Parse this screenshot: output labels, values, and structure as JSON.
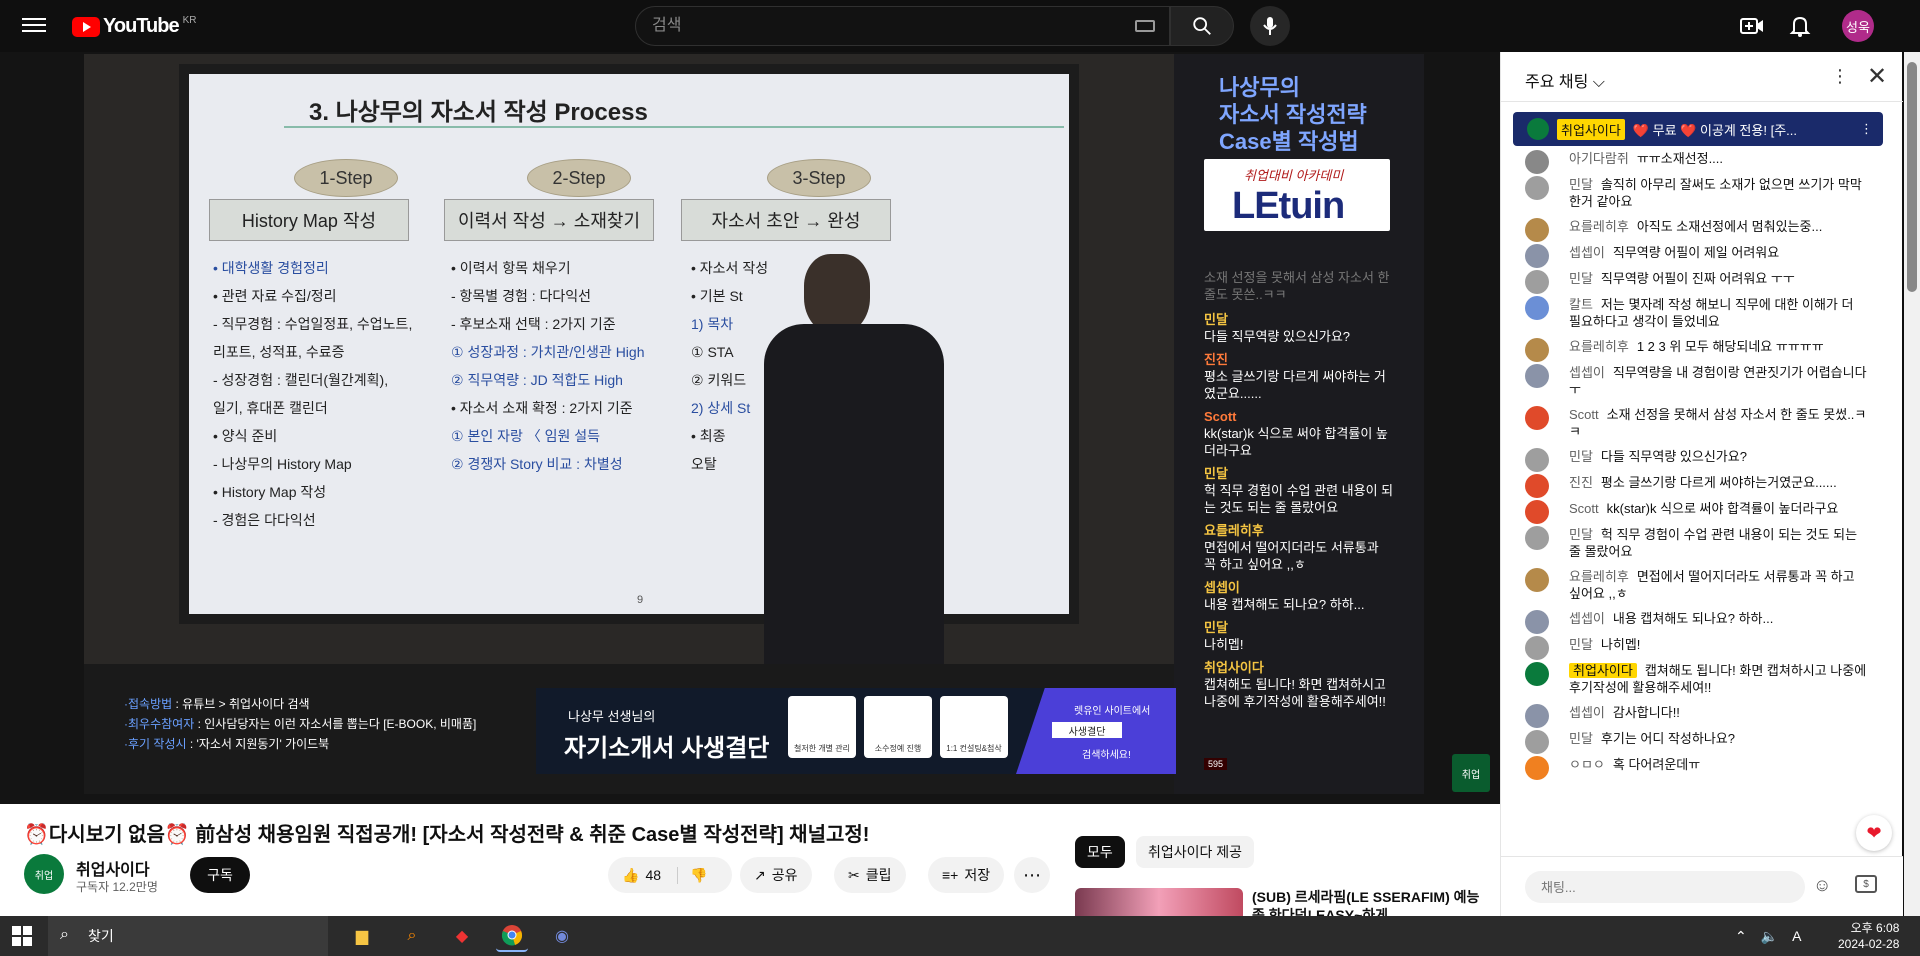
{
  "topbar": {
    "logo_text": "YouTube",
    "logo_country": "KR",
    "search_placeholder": "검색",
    "avatar_label": "성욱"
  },
  "slide": {
    "title": "3. 나상무의 자소서 작성 Process",
    "steps": [
      {
        "pill": "1-Step",
        "box": "History Map 작성"
      },
      {
        "pill": "2-Step",
        "box": "이력서 작성 → 소재찾기"
      },
      {
        "pill": "3-Step",
        "box": "자소서 초안 → 완성"
      }
    ],
    "col1": [
      "• 대학생활 경험정리",
      "• 관련 자료 수집/정리",
      " - 직무경험 : 수업일정표, 수업노트,",
      "   리포트, 성적표, 수료증",
      " - 성장경험 : 캘린더(월간계획),",
      "   일기, 휴대폰 캘린더",
      "• 양식 준비",
      " - 나상무의 History Map",
      "• History Map 작성",
      " - 경험은 다다익선"
    ],
    "col2": [
      "• 이력서 항목 채우기",
      " - 항목별 경험 : 다다익선",
      " - 후보소재 선택 : 2가지 기준",
      " ① 성장과정 : 가치관/인생관 High",
      " ② 직무역량 : JD 적합도 High",
      "• 자소서 소재 확정 : 2가지 기준",
      " ① 본인 자랑 〈 임원 설득",
      " ② 경쟁자 Story 비교 : 차별성"
    ],
    "col3": [
      "• 자소서 작성",
      "• 기본 St",
      " 1) 목차",
      " ① STA",
      " ② 키워드",
      " 2) 상세 St",
      "",
      "",
      "• 최종",
      "   오탈"
    ],
    "page_number": "9"
  },
  "brand": {
    "title_lines": [
      "나상무의",
      "자소서 작성전략",
      "Case별 작성법"
    ],
    "logo_small": "취업대비 아카데미",
    "logo_big": "LEtuin"
  },
  "overlay_chat": {
    "faded": "소재 선정을 못해서 삼성 자소서 한 줄도 못쓴..ㅋㅋ",
    "messages": [
      {
        "name": "민달",
        "text": "다들 직무역량 있으신가요?"
      },
      {
        "name": "진진",
        "text": "평소 글쓰기랑 다르게 써야하는 거였군요......"
      },
      {
        "name": "Scott",
        "text": "kk(star)k 식으로 써야 합격률이 높더라구요"
      },
      {
        "name": "민달",
        "text": "헉 직무 경험이 수업 관련 내용이 되는 것도 되는 줄 몰랐어요"
      },
      {
        "name": "요를레히후",
        "text": "면접에서 떨어지더라도 서류통과 꼭 하고 싶어요 ,,ㅎ"
      },
      {
        "name": "셉셉이",
        "text": "내용 캡쳐해도 되나요? 하하..."
      },
      {
        "name": "민달",
        "text": "나히멥!"
      },
      {
        "name": "취업사이다",
        "text": "캡쳐해도 됩니다! 화면 캡쳐하시고 나중에 후기작성에 활용해주세여!!"
      }
    ],
    "count": "595"
  },
  "bottom_strip": {
    "info": [
      {
        "key": "·접속방법",
        "value": " : 유튜브 > 취업사이다 검색"
      },
      {
        "key": "·최우수참여자",
        "value": " : 인사담당자는 이런 자소서를 뽑는다 [E-BOOK, 비매품]"
      },
      {
        "key": "·후기 작성시",
        "value": " : '자소서 지원동기' 가이드북"
      }
    ],
    "banner_small": "나상무 선생님의",
    "banner_big": "자기소개서 사생결단",
    "cards": [
      "철저한 개별 관리",
      "소수정예 진행",
      "1:1 컨설팅&첨삭"
    ],
    "cta_line1": "렛유인 사이트에서",
    "cta_box": "사생결단",
    "cta_line2": "검색하세요!"
  },
  "below_video": {
    "title": "⏰다시보기 없음⏰ 前삼성 채용임원 직접공개! [자소서 작성전략 & 취준 Case별 작성전략] 채널고정!",
    "channel_name": "취업사이다",
    "channel_subs": "구독자 12.2만명",
    "subscribe_label": "구독",
    "like_count": "48",
    "share_label": "공유",
    "clip_label": "클립",
    "save_label": "저장",
    "chip_all": "모두",
    "chip_provided": "취업사이다 제공",
    "rec_title": "(SUB) 르세라핌(LE SSERAFIM) 예능 좀 한다던! EASY~하게"
  },
  "chat": {
    "header_title": "주요 채팅",
    "pinned_name": "취업사이다",
    "pinned_text": "❤️ 무료 ❤️ 이공계 전용! [주...",
    "messages": [
      {
        "name": "아기다람쥐",
        "text": "ㅠㅠ소재선정....",
        "color": "#888888"
      },
      {
        "name": "민달",
        "text": "솔직히 아무리 잘써도 소재가 없으면 쓰기가 막막한거 같아요",
        "color": "#9e9e9e"
      },
      {
        "name": "요를레히후",
        "text": "아직도 소재선정에서 멈춰있는중...",
        "color": "#b58a4a"
      },
      {
        "name": "셉셉이",
        "text": "직무역량 어필이 제일 어려워요",
        "color": "#8a93a8"
      },
      {
        "name": "민달",
        "text": "직무역량 어필이 진짜 어려워요 ㅜㅜ",
        "color": "#9e9e9e"
      },
      {
        "name": "칼트",
        "text": "저는 몇자례 작성 해보니 직무에 대한 이해가 더 필요하다고 생각이 들었네요",
        "color": "#6b8fd6"
      },
      {
        "name": "요를레히후",
        "text": "1 2 3 위 모두 해당되네요 ㅠㅠㅠㅠ",
        "color": "#b58a4a"
      },
      {
        "name": "셉셉이",
        "text": "직무역량을 내 경험이랑 연관짓기가 어렵습니다 ㅜ",
        "color": "#8a93a8"
      },
      {
        "name": "Scott",
        "text": "소재 선정을 못해서 삼성 자소서 한 줄도 못썼..ㅋㅋ",
        "color": "#e04a2a"
      },
      {
        "name": "민달",
        "text": "다들 직무역량 있으신가요?",
        "color": "#9e9e9e"
      },
      {
        "name": "진진",
        "text": "평소 글쓰기랑 다르게 써야하는거였군요......",
        "color": "#e04a2a"
      },
      {
        "name": "Scott",
        "text": "kk(star)k 식으로 써야 합격률이 높더라구요",
        "color": "#e04a2a"
      },
      {
        "name": "민달",
        "text": "헉 직무 경험이 수업 관련 내용이 되는 것도 되는 줄 몰랐어요",
        "color": "#9e9e9e"
      },
      {
        "name": "요를레히후",
        "text": "면접에서 떨어지더라도 서류통과 꼭 하고 싶어요 ,,ㅎ",
        "color": "#b58a4a"
      },
      {
        "name": "셉셉이",
        "text": "내용 캡쳐해도 되나요? 하하...",
        "color": "#8a93a8"
      },
      {
        "name": "민달",
        "text": "나히멥!",
        "color": "#9e9e9e"
      },
      {
        "name": "취업사이다",
        "text": "캡쳐해도 됩니다! 화면 캡쳐하시고 나중에 후기작성에 활용해주세여!!",
        "color": "#0a7a3c",
        "owner": true
      },
      {
        "name": "셉셉이",
        "text": "감사합니다!!",
        "color": "#8a93a8"
      },
      {
        "name": "민달",
        "text": "후기는 어디 작성하나요?",
        "color": "#9e9e9e"
      },
      {
        "name": "ㅇㅁㅇ",
        "text": "혹 다어려운데ㅠ",
        "color": "#f08020"
      }
    ],
    "input_placeholder": "채팅..."
  },
  "taskbar": {
    "search_label": "찾기",
    "clock_time": "오후 6:08",
    "clock_date": "2024-02-28",
    "tray_lang": "A"
  }
}
